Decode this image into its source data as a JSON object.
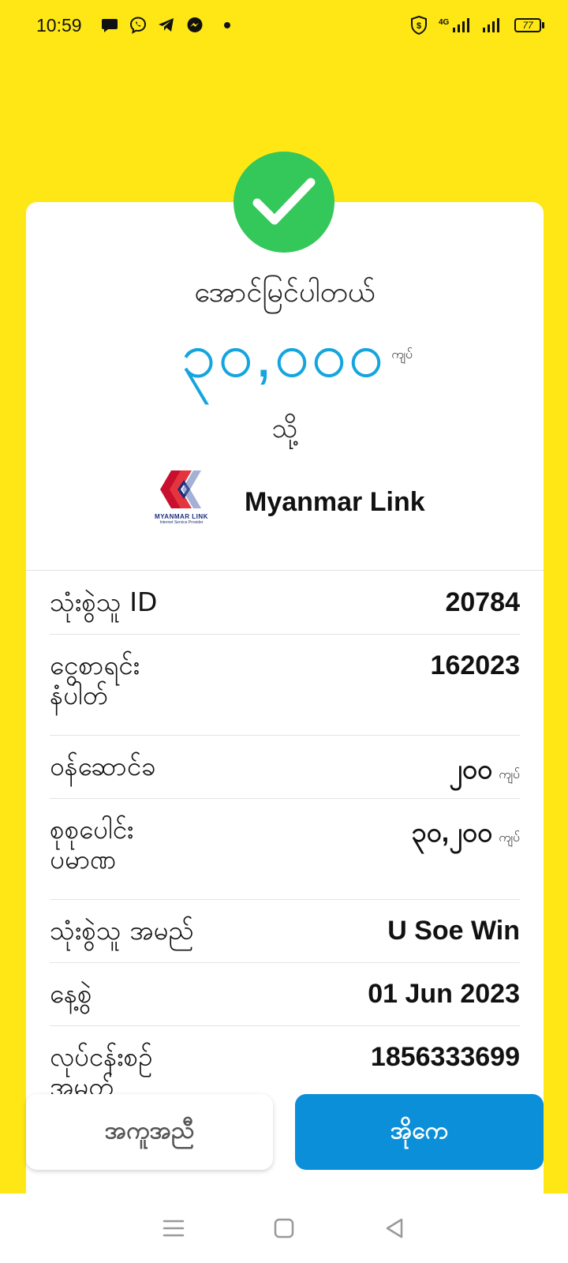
{
  "status_bar": {
    "time": "10:59",
    "battery": "77",
    "network": "4G"
  },
  "colors": {
    "background": "#FEE715",
    "success_green": "#34C759",
    "amount_blue": "#14A5DF",
    "primary_button": "#0A8FD8"
  },
  "receipt": {
    "title": "အောင်မြင်ပါတယ်",
    "amount": "၃၀,၀၀၀",
    "amount_unit": "ကျပ်",
    "to_label": "သို့",
    "merchant_name": "Myanmar Link",
    "merchant_logo_text": "MYANMAR LINK",
    "merchant_logo_sub": "Internet Service Provider"
  },
  "details": [
    {
      "label": "သုံးစွဲသူ ID",
      "value": "20784",
      "unit": ""
    },
    {
      "label": "ငွေစာရင်း နံပါတ်",
      "value": "162023",
      "unit": ""
    },
    {
      "label": "ဝန်ဆောင်ခ",
      "value": "၂၀၀",
      "unit": "ကျပ်"
    },
    {
      "label": "စုစုပေါင်း ပမာဏ",
      "value": "၃၀,၂၀၀",
      "unit": "ကျပ်"
    },
    {
      "label": "သုံးစွဲသူ အမည်",
      "value": "U Soe Win",
      "unit": ""
    },
    {
      "label": "နေ့စွဲ",
      "value": "01 Jun 2023",
      "unit": ""
    },
    {
      "label": "လုပ်ငန်းစဉ် အမှတ်",
      "value": "1856333699",
      "unit": ""
    }
  ],
  "buttons": {
    "help": "အကူအညီ",
    "ok": "အိုကေ"
  },
  "icons": [
    "chat-icon",
    "viber-icon",
    "telegram-icon",
    "messenger-icon",
    "shield-icon",
    "signal-icon",
    "battery-icon",
    "checkmark-icon",
    "menu-icon",
    "home-icon",
    "back-icon"
  ]
}
